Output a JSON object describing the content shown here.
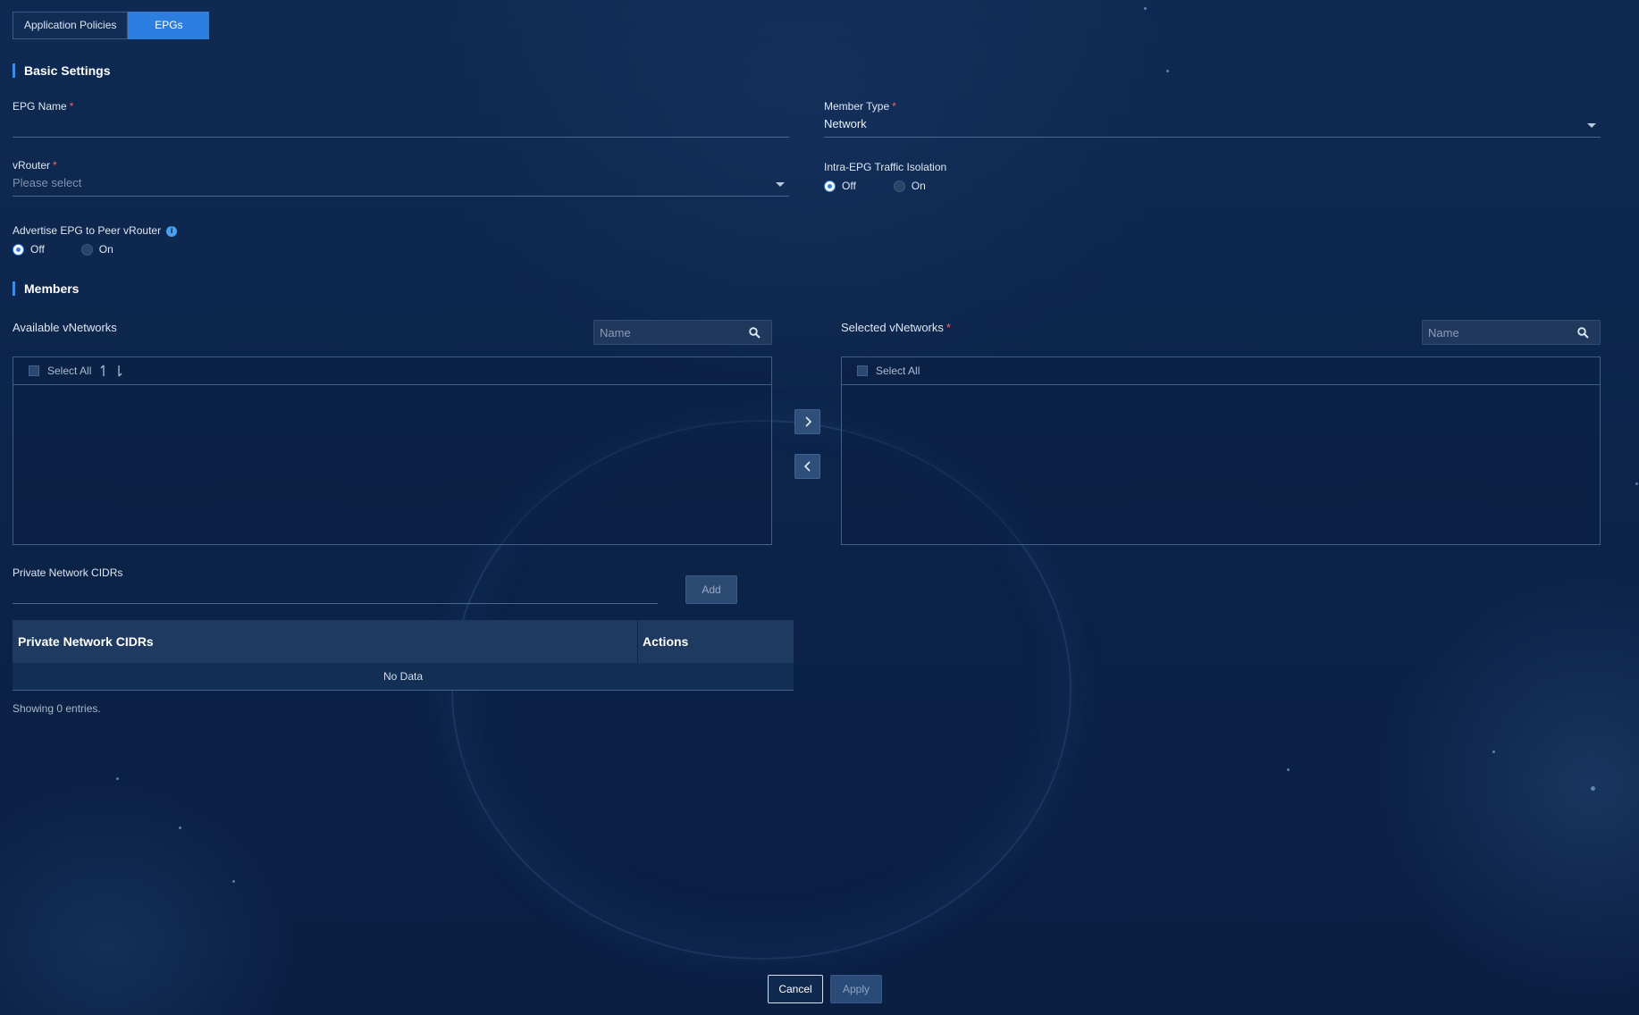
{
  "tabs": [
    {
      "label": "Application Policies",
      "active": false
    },
    {
      "label": "EPGs",
      "active": true
    }
  ],
  "basic_settings": {
    "title": "Basic Settings",
    "epg_name": {
      "label": "EPG Name",
      "value": ""
    },
    "member_type": {
      "label": "Member Type",
      "value": "Network"
    },
    "vrouter": {
      "label": "vRouter",
      "placeholder": "Please select"
    },
    "intra_epg": {
      "label": "Intra-EPG Traffic Isolation",
      "options": [
        "Off",
        "On"
      ],
      "selected": "Off"
    },
    "advertise": {
      "label": "Advertise EPG to Peer vRouter",
      "options": [
        "Off",
        "On"
      ],
      "selected": "Off"
    }
  },
  "members": {
    "title": "Members",
    "available": {
      "title": "Available vNetworks",
      "search_placeholder": "Name",
      "select_all": "Select All",
      "items": []
    },
    "selected": {
      "title": "Selected vNetworks",
      "search_placeholder": "Name",
      "select_all": "Select All",
      "items": []
    }
  },
  "cidrs": {
    "label": "Private Network CIDRs",
    "add_label": "Add",
    "columns": [
      "Private Network CIDRs",
      "Actions"
    ],
    "empty_text": "No Data",
    "footer": "Showing 0 entries."
  },
  "footer": {
    "cancel": "Cancel",
    "apply": "Apply"
  },
  "colors": {
    "accent": "#2c7fe0",
    "required": "#ff5f5f",
    "background": "#0c244a"
  }
}
